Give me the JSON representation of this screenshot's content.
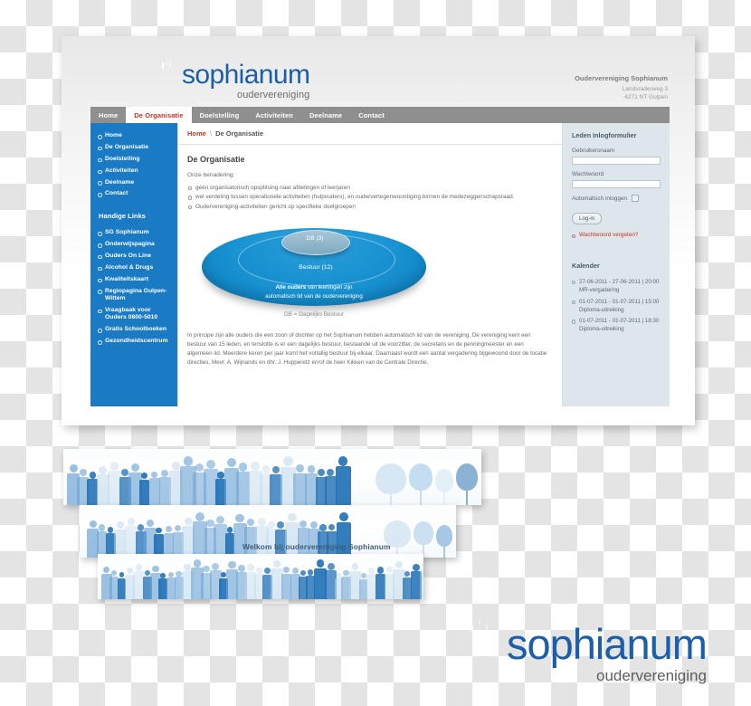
{
  "header": {
    "brand_name": "sophianum",
    "brand_sub": "oudervereniging",
    "org_line": "Oudervereniging Sophianum",
    "address_line1": "Landsraderweg 3",
    "address_line2": "6271 NT Gulpen"
  },
  "nav": {
    "items": [
      {
        "label": "Home",
        "active": false
      },
      {
        "label": "De Organisatie",
        "active": true
      },
      {
        "label": "Doelstelling",
        "active": false
      },
      {
        "label": "Activiteiten",
        "active": false
      },
      {
        "label": "Deelname",
        "active": false
      },
      {
        "label": "Contact",
        "active": false
      }
    ]
  },
  "sidebar": {
    "menu": [
      {
        "label": "Home"
      },
      {
        "label": "De Organisatie"
      },
      {
        "label": "Doelstelling"
      },
      {
        "label": "Activiteiten"
      },
      {
        "label": "Deelname"
      },
      {
        "label": "Contact"
      }
    ],
    "links_title": "Handige Links",
    "links": [
      {
        "label": "SG Sophianum"
      },
      {
        "label": "Onderwijspagina"
      },
      {
        "label": "Ouders On Line"
      },
      {
        "label": "Alcohol & Drugs"
      },
      {
        "label": "Kwaliteitskaart"
      },
      {
        "label": "Regiopagina Gulpen-Wittem"
      },
      {
        "label": "Vraagbaak voor Ouders 0800-5010"
      },
      {
        "label": "Gratis Schoolboeken"
      },
      {
        "label": "Gezondheidscentrum"
      }
    ]
  },
  "breadcrumb": {
    "home": "Home",
    "separator": "\\",
    "current": "De Organisatie"
  },
  "main": {
    "title": "De Organisatie",
    "lead": "Onze benadering:",
    "bullets": [
      "géén organisatorisch opsplitsing naar afdelingen of leerjaren",
      "wel verdeling tussen operationele activiteiten (hulpouders), en oudervertegenwoordiging binnen de medezeggenschapsraad.",
      "Oudervereniging-activiteiten gericht op specifieke doelgroepen"
    ],
    "diagram": {
      "inner_label": "DB (3)",
      "middle_label": "Bestuur (12)",
      "outer_label_bold": "Alle ouders",
      "outer_label_rest": " van leerlingen zijn",
      "outer_label_line2": "automatisch lid van de oudervereniging",
      "caption": "DB = Dagelijks Bestuur"
    },
    "paragraph": "In principe zijn alle ouders die een zoon of dochter op het Sophianum hebben automatisch lid van de vereniging. De vereniging kent een bestuur van 15 leden, en tenslotte is er een dagelijks bestuur, bestaande uit de voorzitter, de secretaris en de penningmeester en een algemeen lid. Meerdere keren per jaar komt het voltallig bestuur bij elkaar. Daarnaast wordt een aantal vergadering bijgewoond door de locatie directies, Mevr. A. Wijnands en dhr. J. Hupperetz en/of de heer Kikken van de Centrale Directie."
  },
  "login": {
    "title": "Leden Inlogformulier",
    "username_label": "Gebruikersnaam",
    "username_value": "",
    "password_label": "Wachtwoord",
    "password_value": "",
    "auto_login_label": "Automatisch inloggen",
    "login_button": "Log-in",
    "forgot_link": "Wachtwoord vergeten?"
  },
  "calendar": {
    "title": "Kalender",
    "events": [
      "27-06-2011 - 27-06-2011 | 20:00 MR-vergadering",
      "01-07-2011 - 01-07-2011 | 15:00 Diploma-uitreiking",
      "01-07-2011 - 01-07-2011 | 18:30 Diploma-uitreiking"
    ]
  },
  "banners": {
    "caption": "Welkom bij oudervereniging Sophianum"
  },
  "footer_logo": {
    "name": "sophianum",
    "sub": "oudervereniging"
  },
  "colors": {
    "brand_blue": "#1b5faa",
    "sidebar_blue": "#1a7bc4",
    "accent_red": "#cc3322",
    "nav_gray": "#8f8f8f",
    "right_panel": "#dde6eb",
    "diagram_blue": "#1b96d4"
  }
}
